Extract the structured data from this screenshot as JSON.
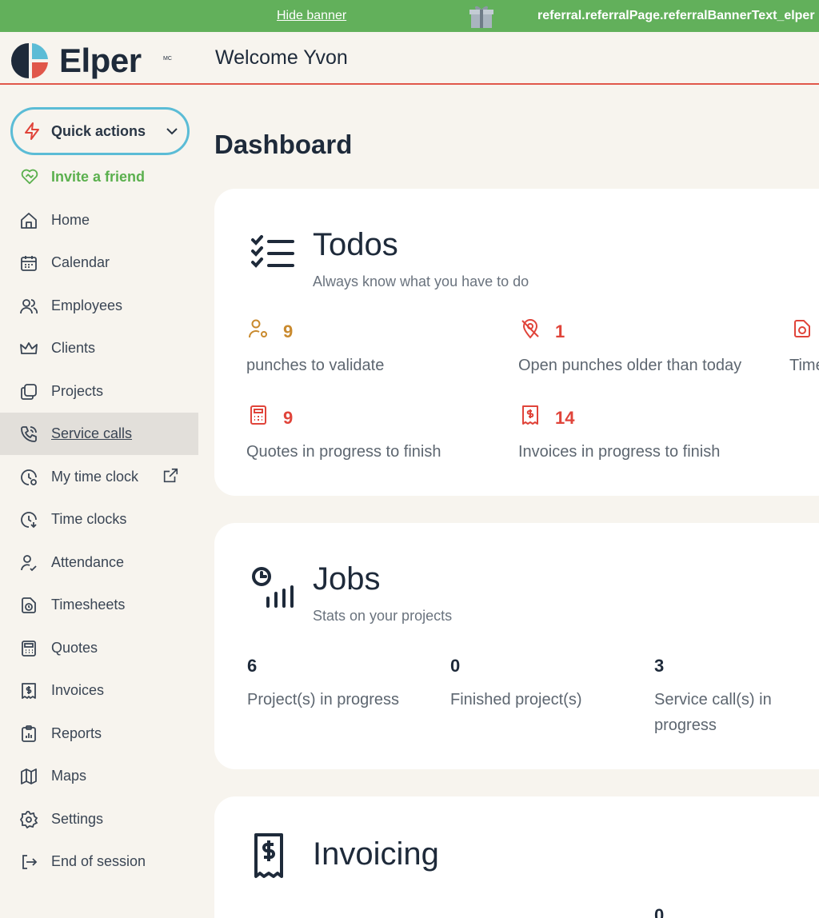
{
  "banner": {
    "hide_label": "Hide banner",
    "text": "referral.referralPage.referralBannerText_elper"
  },
  "header": {
    "brand": "Elper",
    "brand_mark": "MC",
    "welcome": "Welcome Yvon"
  },
  "sidebar": {
    "quick_actions": "Quick actions",
    "invite": "Invite a friend",
    "items": [
      {
        "label": "Home",
        "icon": "home-icon"
      },
      {
        "label": "Calendar",
        "icon": "calendar-icon"
      },
      {
        "label": "Employees",
        "icon": "employees-icon"
      },
      {
        "label": "Clients",
        "icon": "crown-icon"
      },
      {
        "label": "Projects",
        "icon": "projects-icon"
      },
      {
        "label": "Service calls",
        "icon": "phone-icon",
        "active": true
      },
      {
        "label": "My time clock",
        "icon": "clock-icon"
      },
      {
        "label": "Time clocks",
        "icon": "clock-download-icon"
      },
      {
        "label": "Attendance",
        "icon": "attendance-icon"
      },
      {
        "label": "Timesheets",
        "icon": "timesheet-icon"
      },
      {
        "label": "Quotes",
        "icon": "calculator-icon"
      },
      {
        "label": "Invoices",
        "icon": "invoice-icon"
      },
      {
        "label": "Reports",
        "icon": "report-icon"
      },
      {
        "label": "Maps",
        "icon": "map-icon"
      },
      {
        "label": "Settings",
        "icon": "gear-icon"
      },
      {
        "label": "End of session",
        "icon": "logout-icon"
      }
    ]
  },
  "main": {
    "title": "Dashboard",
    "todos": {
      "title": "Todos",
      "subtitle": "Always know what you have to do",
      "stats": [
        {
          "value": "9",
          "label": "punches to validate"
        },
        {
          "value": "1",
          "label": "Open punches older than today"
        },
        {
          "value": "",
          "label": "Time"
        },
        {
          "value": "9",
          "label": "Quotes in progress to finish"
        },
        {
          "value": "14",
          "label": "Invoices in progress to finish"
        }
      ]
    },
    "jobs": {
      "title": "Jobs",
      "subtitle": "Stats on your projects",
      "stats": [
        {
          "value": "6",
          "label": "Project(s) in progress"
        },
        {
          "value": "0",
          "label": "Finished project(s)"
        },
        {
          "value": "3",
          "label": "Service call(s) in progress"
        }
      ]
    },
    "invoicing": {
      "title": "Invoicing",
      "partial_value": "0"
    }
  },
  "colors": {
    "banner": "#62b05b",
    "accent_red": "#e0443a",
    "accent_orange": "#c98a2e",
    "quick_border": "#5bbcd6",
    "invite_green": "#5bb04e"
  }
}
